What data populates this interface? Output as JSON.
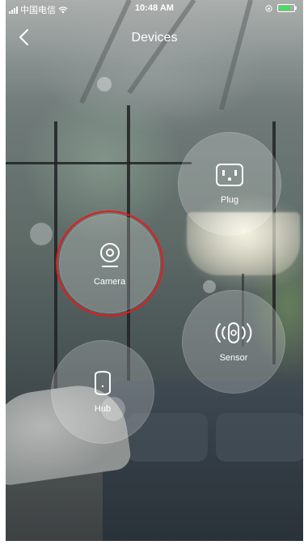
{
  "status_bar": {
    "carrier": "中国电信",
    "time": "10:48 AM",
    "battery_level": 0.85,
    "battery_color": "#4cd964"
  },
  "header": {
    "title": "Devices",
    "back_icon": "chevron-left-icon"
  },
  "devices": [
    {
      "id": "plug",
      "label": "Plug",
      "icon": "plug-icon"
    },
    {
      "id": "camera",
      "label": "Camera",
      "icon": "camera-icon",
      "highlighted": true
    },
    {
      "id": "sensor",
      "label": "Sensor",
      "icon": "sensor-icon"
    },
    {
      "id": "hub",
      "label": "Hub",
      "icon": "hub-icon"
    }
  ],
  "colors": {
    "highlight": "#e8191d",
    "text": "#ffffff"
  }
}
